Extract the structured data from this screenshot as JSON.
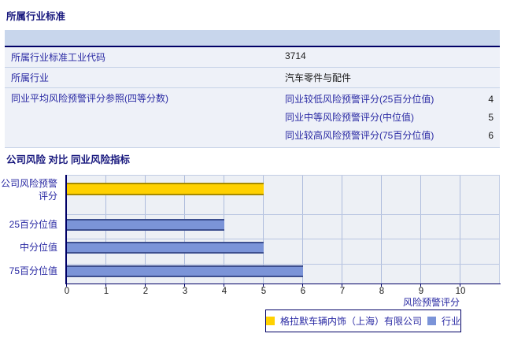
{
  "section1": {
    "title": "所属行业标准",
    "table": {
      "rows": [
        {
          "label": "所属行业标准工业代码",
          "value": "3714"
        },
        {
          "label": "所属行业",
          "value": "汽车零件与配件"
        },
        {
          "label": "同业平均风险预警评分参照(四等分数)",
          "sub_rows": [
            {
              "label": "同业较低风险预警评分(25百分位值)",
              "value": "4"
            },
            {
              "label": "同业中等风险预警评分(中位值)",
              "value": "5"
            },
            {
              "label": "同业较高风险预警评分(75百分位值)",
              "value": "6"
            }
          ]
        }
      ]
    }
  },
  "section2": {
    "title": "公司风险 对比 同业风险指标"
  },
  "chart_data": {
    "type": "bar",
    "orientation": "horizontal",
    "title": "公司风险 对比 同业风险指标",
    "categories": [
      "公司风险预警评分",
      "25百分位值",
      "中分位值",
      "75百分位值"
    ],
    "values": [
      5,
      4,
      5,
      6
    ],
    "series_of_bar": [
      "company",
      "industry",
      "industry",
      "industry"
    ],
    "xlabel": "风险预警评分",
    "ylabel": "",
    "xlim": [
      0,
      10
    ],
    "x_ticks": [
      0,
      1,
      2,
      3,
      4,
      5,
      6,
      7,
      8,
      9,
      10
    ],
    "grid": "vertical",
    "legend_position": "bottom",
    "legend": [
      {
        "series": "company",
        "label": "格拉默车辆内饰（上海）有限公司",
        "color": "#FFD100"
      },
      {
        "series": "industry",
        "label": "行业",
        "color": "#7B94D8"
      }
    ],
    "colors": {
      "company": "#FFD100",
      "company_edge": "#A68A00",
      "industry": "#7B94D8",
      "industry_edge": "#3D4F8F"
    }
  }
}
